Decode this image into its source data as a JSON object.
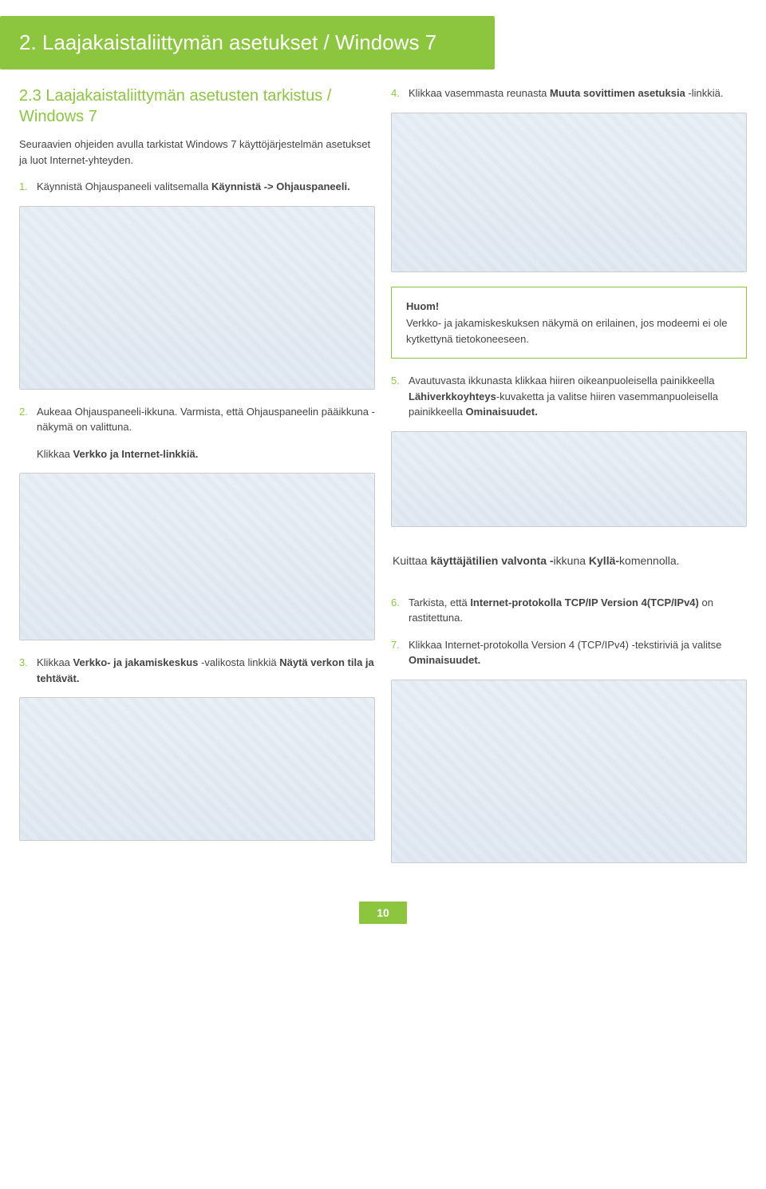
{
  "header": "2. Laajakaistaliittymän asetukset / Windows 7",
  "left": {
    "section_title": "2.3 Laajakaistaliittymän asetusten tarkistus / Windows 7",
    "intro": "Seuraavien ohjeiden avulla tarkistat Windows 7 käyttöjärjestelmän asetukset ja luot Internet-yhteyden.",
    "step1_num": "1.",
    "step1_a": "Käynnistä Ohjauspaneeli valitsemalla ",
    "step1_b": "Käynnistä -> Ohjauspaneeli.",
    "step2_num": "2.",
    "step2_a": "Aukeaa Ohjauspaneeli-ikkuna. Varmista, että Ohjauspaneelin pääikkuna -näkymä on valittuna.",
    "step2_b_a": "Klikkaa ",
    "step2_b_b": "Verkko ja Internet-linkkiä.",
    "step3_num": "3.",
    "step3_a": "Klikkaa ",
    "step3_b": "Verkko- ja jakamiskeskus",
    "step3_c": " -valikosta linkkiä ",
    "step3_d": "Näytä verkon tila ja tehtävät."
  },
  "right": {
    "step4_num": "4.",
    "step4_a": "Klikkaa vasemmasta reunasta ",
    "step4_b": "Muuta sovittimen asetuksia",
    "step4_c": " -linkkiä.",
    "huom_title": "Huom!",
    "huom_body": "Verkko- ja jakamiskeskuksen näkymä on erilainen, jos modeemi ei ole kytkettynä tietokoneeseen.",
    "step5_num": "5.",
    "step5_a": "Avautuvasta ikkunasta klikkaa hiiren oikeanpuoleisella painikkeella ",
    "step5_b": "Lähiverkkoyhteys",
    "step5_c": "-kuvaketta ja valitse hiiren vasemmanpuoleisella painikkeella ",
    "step5_d": "Ominaisuudet.",
    "kuittaa_a": "Kuittaa ",
    "kuittaa_b": "käyttäjätilien valvonta -",
    "kuittaa_c": "ikkuna ",
    "kuittaa_d": "Kyllä-",
    "kuittaa_e": "komennolla.",
    "step6_num": "6.",
    "step6_a": "Tarkista, että ",
    "step6_b": "Internet-protokolla TCP/IP Version 4(TCP/IPv4)",
    "step6_c": " on rastitettuna.",
    "step7_num": "7.",
    "step7_a": "Klikkaa Internet-protokolla Version 4 (TCP/IPv4) -tekstiriviä ja valitse ",
    "step7_b": "Ominaisuudet."
  },
  "page_number": "10"
}
